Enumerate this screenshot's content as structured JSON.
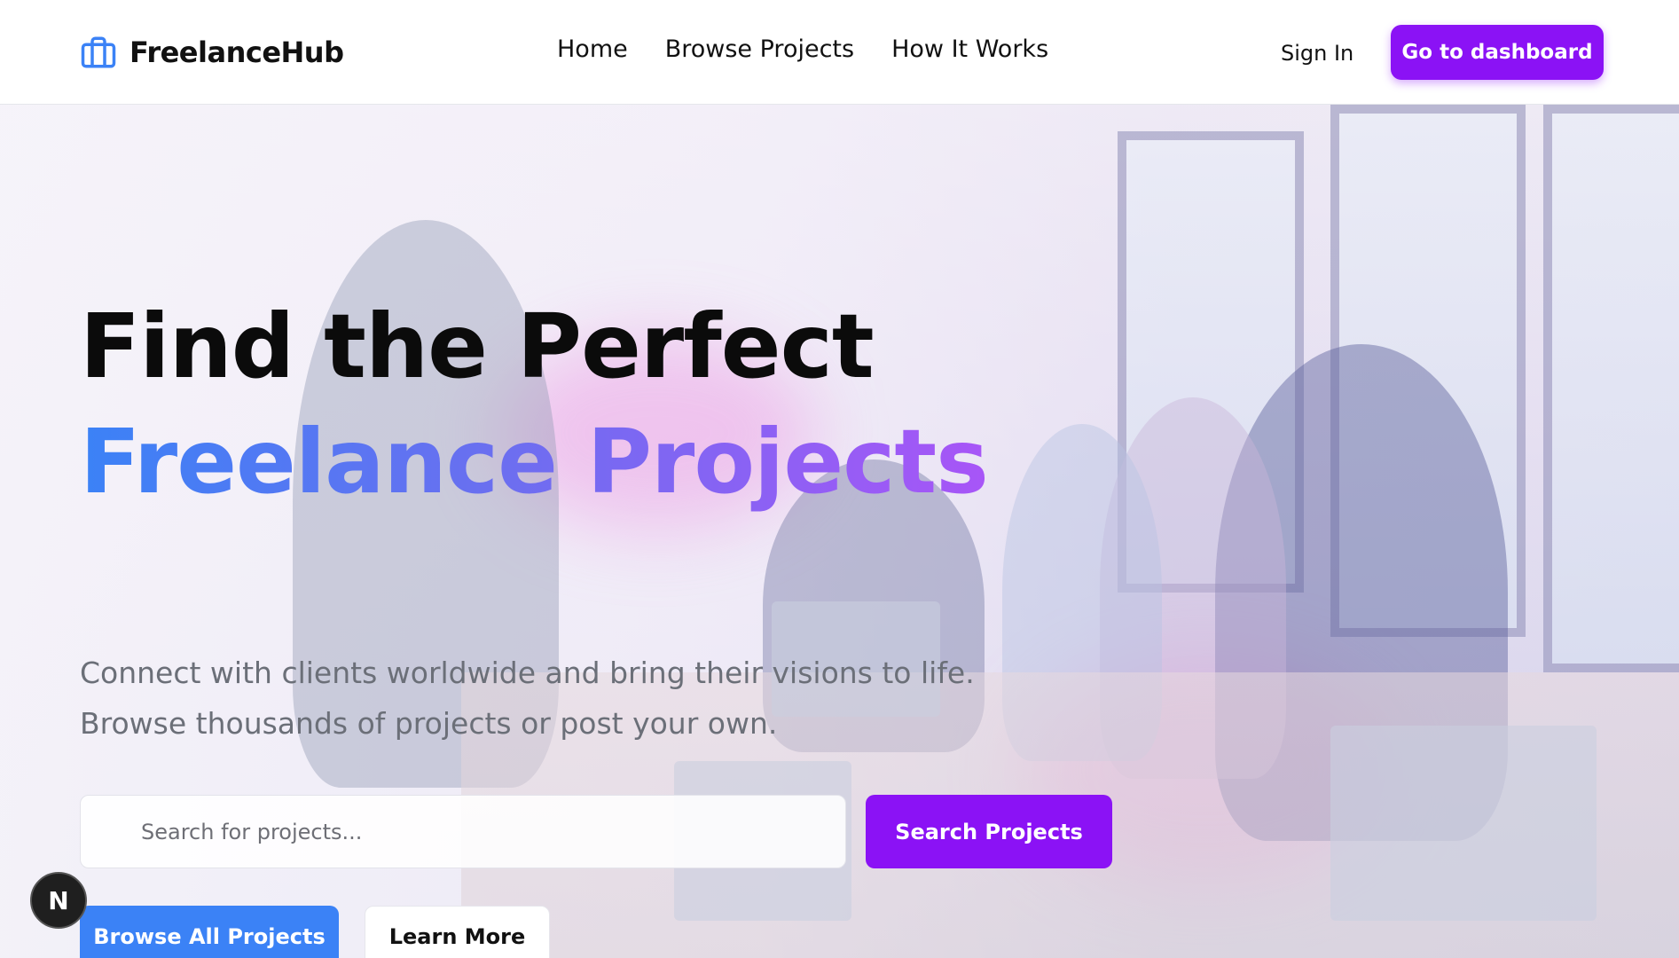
{
  "header": {
    "brand_name": "FreelanceHub",
    "brand_icon": "briefcase-icon",
    "nav": [
      {
        "label": "Home"
      },
      {
        "label": "Browse Projects"
      },
      {
        "label": "How It Works"
      }
    ],
    "sign_in_label": "Sign In",
    "dashboard_label": "Go to dashboard"
  },
  "hero": {
    "title_line1": "Find the Perfect",
    "title_line2": "Freelance Projects",
    "subtitle": "Connect with clients worldwide and bring their visions to life. Browse thousands of projects or post your own.",
    "search": {
      "placeholder": "Search for projects...",
      "value": "",
      "button_label": "Search Projects"
    },
    "browse_label": "Browse All Projects",
    "learn_label": "Learn More"
  },
  "dev_badge": {
    "label": "N"
  },
  "colors": {
    "accent_purple": "#8b12f5",
    "accent_blue": "#3b82f6",
    "gradient_end": "#a855f7",
    "text_muted": "#6b6f78"
  }
}
